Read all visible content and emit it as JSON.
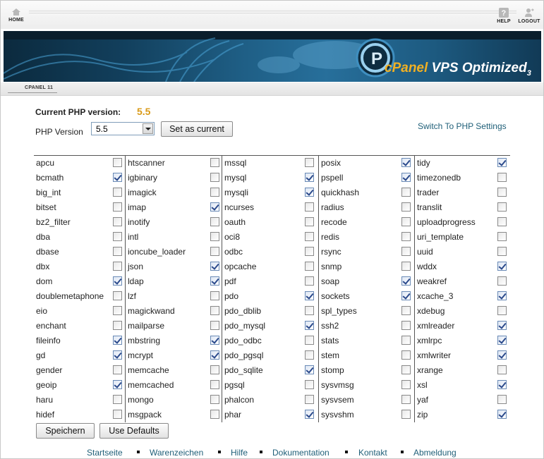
{
  "topbar": {
    "home_label": "HOME",
    "help_label": "HELP",
    "logout_label": "LOGOUT"
  },
  "banner": {
    "brand_c": "c",
    "brand_panel": "Panel",
    "brand_vps": "VPS Optimized",
    "brand_num": "3"
  },
  "subbar": {
    "tag": "CPANEL 11"
  },
  "php": {
    "current_label": "Current PHP version:",
    "current_value": "5.5",
    "version_label": "PHP Version",
    "selected_version": "5.5",
    "set_current_button": "Set as current",
    "switch_link": "Switch To PHP Settings"
  },
  "extensions": [
    [
      {
        "name": "apcu",
        "checked": false
      },
      {
        "name": "bcmath",
        "checked": true
      },
      {
        "name": "big_int",
        "checked": false
      },
      {
        "name": "bitset",
        "checked": false
      },
      {
        "name": "bz2_filter",
        "checked": false
      },
      {
        "name": "dba",
        "checked": false
      },
      {
        "name": "dbase",
        "checked": false
      },
      {
        "name": "dbx",
        "checked": false
      },
      {
        "name": "dom",
        "checked": true
      },
      {
        "name": "doublemetaphone",
        "checked": false
      },
      {
        "name": "eio",
        "checked": false
      },
      {
        "name": "enchant",
        "checked": false
      },
      {
        "name": "fileinfo",
        "checked": true
      },
      {
        "name": "gd",
        "checked": true
      },
      {
        "name": "gender",
        "checked": false
      },
      {
        "name": "geoip",
        "checked": true
      },
      {
        "name": "haru",
        "checked": false
      },
      {
        "name": "hidef",
        "checked": false
      }
    ],
    [
      {
        "name": "htscanner",
        "checked": false
      },
      {
        "name": "igbinary",
        "checked": false
      },
      {
        "name": "imagick",
        "checked": false
      },
      {
        "name": "imap",
        "checked": true
      },
      {
        "name": "inotify",
        "checked": false
      },
      {
        "name": "intl",
        "checked": false
      },
      {
        "name": "ioncube_loader",
        "checked": false
      },
      {
        "name": "json",
        "checked": true
      },
      {
        "name": "ldap",
        "checked": true
      },
      {
        "name": "lzf",
        "checked": false
      },
      {
        "name": "magickwand",
        "checked": false
      },
      {
        "name": "mailparse",
        "checked": false
      },
      {
        "name": "mbstring",
        "checked": true
      },
      {
        "name": "mcrypt",
        "checked": true
      },
      {
        "name": "memcache",
        "checked": false
      },
      {
        "name": "memcached",
        "checked": false
      },
      {
        "name": "mongo",
        "checked": false
      },
      {
        "name": "msgpack",
        "checked": false
      }
    ],
    [
      {
        "name": "mssql",
        "checked": false
      },
      {
        "name": "mysql",
        "checked": true
      },
      {
        "name": "mysqli",
        "checked": true
      },
      {
        "name": "ncurses",
        "checked": false
      },
      {
        "name": "oauth",
        "checked": false
      },
      {
        "name": "oci8",
        "checked": false
      },
      {
        "name": "odbc",
        "checked": false
      },
      {
        "name": "opcache",
        "checked": false
      },
      {
        "name": "pdf",
        "checked": false
      },
      {
        "name": "pdo",
        "checked": true
      },
      {
        "name": "pdo_dblib",
        "checked": false
      },
      {
        "name": "pdo_mysql",
        "checked": true
      },
      {
        "name": "pdo_odbc",
        "checked": false
      },
      {
        "name": "pdo_pgsql",
        "checked": false
      },
      {
        "name": "pdo_sqlite",
        "checked": true
      },
      {
        "name": "pgsql",
        "checked": false
      },
      {
        "name": "phalcon",
        "checked": false
      },
      {
        "name": "phar",
        "checked": true
      }
    ],
    [
      {
        "name": "posix",
        "checked": true
      },
      {
        "name": "pspell",
        "checked": true
      },
      {
        "name": "quickhash",
        "checked": false
      },
      {
        "name": "radius",
        "checked": false
      },
      {
        "name": "recode",
        "checked": false
      },
      {
        "name": "redis",
        "checked": false
      },
      {
        "name": "rsync",
        "checked": false
      },
      {
        "name": "snmp",
        "checked": false
      },
      {
        "name": "soap",
        "checked": true
      },
      {
        "name": "sockets",
        "checked": true
      },
      {
        "name": "spl_types",
        "checked": false
      },
      {
        "name": "ssh2",
        "checked": false
      },
      {
        "name": "stats",
        "checked": false
      },
      {
        "name": "stem",
        "checked": false
      },
      {
        "name": "stomp",
        "checked": false
      },
      {
        "name": "sysvmsg",
        "checked": false
      },
      {
        "name": "sysvsem",
        "checked": false
      },
      {
        "name": "sysvshm",
        "checked": false
      }
    ],
    [
      {
        "name": "tidy",
        "checked": true
      },
      {
        "name": "timezonedb",
        "checked": false
      },
      {
        "name": "trader",
        "checked": false
      },
      {
        "name": "translit",
        "checked": false
      },
      {
        "name": "uploadprogress",
        "checked": false
      },
      {
        "name": "uri_template",
        "checked": false
      },
      {
        "name": "uuid",
        "checked": false
      },
      {
        "name": "wddx",
        "checked": true
      },
      {
        "name": "weakref",
        "checked": false
      },
      {
        "name": "xcache_3",
        "checked": true
      },
      {
        "name": "xdebug",
        "checked": false
      },
      {
        "name": "xmlreader",
        "checked": true
      },
      {
        "name": "xmlrpc",
        "checked": true
      },
      {
        "name": "xmlwriter",
        "checked": true
      },
      {
        "name": "xrange",
        "checked": false
      },
      {
        "name": "xsl",
        "checked": true
      },
      {
        "name": "yaf",
        "checked": false
      },
      {
        "name": "zip",
        "checked": true
      }
    ]
  ],
  "actions": {
    "save_button": "Speichern",
    "defaults_button": "Use Defaults"
  },
  "footer": {
    "links": [
      "Startseite",
      "Warenzeichen",
      "Hilfe",
      "Dokumentation",
      "Kontakt",
      "Abmeldung"
    ]
  },
  "colors": {
    "accent_orange": "#d99a18",
    "link_teal": "#1f5f78",
    "banner_blue": "#1f5f86"
  }
}
